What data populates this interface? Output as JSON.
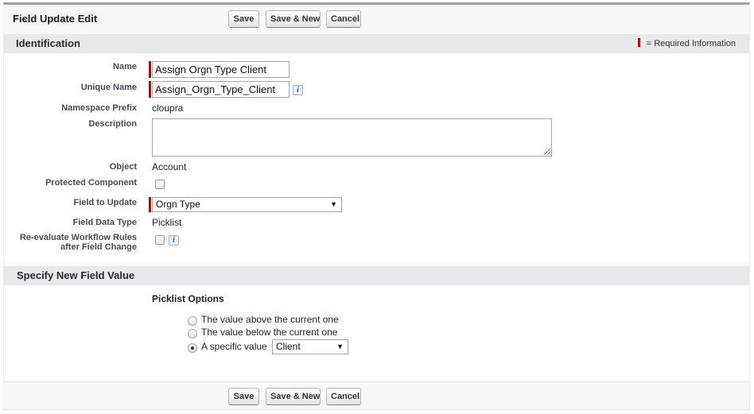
{
  "page": {
    "title": "Field Update Edit"
  },
  "toolbar": {
    "save": "Save",
    "save_new": "Save & New",
    "cancel": "Cancel"
  },
  "identification": {
    "title": "Identification",
    "required_legend": "= Required Information",
    "name_label": "Name",
    "name_value": "Assign Orgn Type Client",
    "unique_name_label": "Unique Name",
    "unique_name_value": "Assign_Orgn_Type_Client",
    "namespace_label": "Namespace Prefix",
    "namespace_value": "cloupra",
    "description_label": "Description",
    "description_value": "",
    "object_label": "Object",
    "object_value": "Account",
    "protected_label": "Protected Component",
    "protected_checked": false,
    "field_to_update_label": "Field to Update",
    "field_to_update_value": "Orgn Type",
    "field_data_type_label": "Field Data Type",
    "field_data_type_value": "Picklist",
    "reevaluate_label_line1": "Re-evaluate Workflow Rules",
    "reevaluate_label_line2": "after Field Change",
    "reevaluate_checked": false
  },
  "new_value": {
    "title": "Specify New Field Value",
    "picklist_heading": "Picklist Options",
    "options": [
      {
        "label": "The value above the current one",
        "selected": false
      },
      {
        "label": "The value below the current one",
        "selected": false
      },
      {
        "label": "A specific value",
        "selected": true
      }
    ],
    "specific_value": "Client"
  },
  "icons": {
    "info": "info-icon",
    "caret": "chevron-down-icon",
    "required": "required-marker"
  },
  "colors": {
    "required": "#c00000",
    "section_bar": "#e5e9ec",
    "info_icon": "#1f63a6"
  }
}
